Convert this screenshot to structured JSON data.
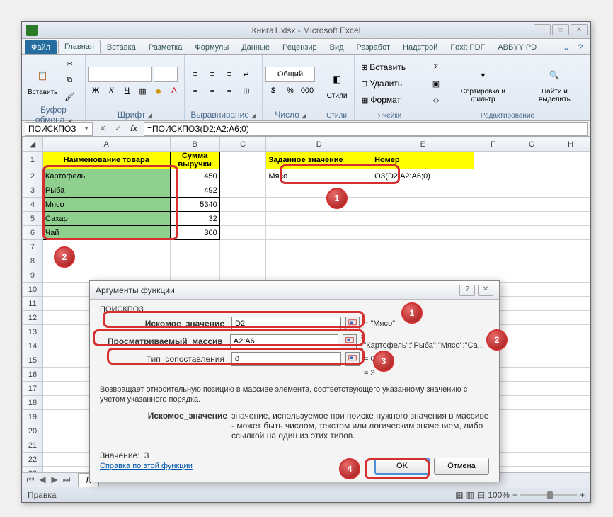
{
  "window": {
    "title": "Книга1.xlsx - Microsoft Excel"
  },
  "tabs": {
    "file": "Файл",
    "items": [
      "Главная",
      "Вставка",
      "Разметка",
      "Формулы",
      "Данные",
      "Рецензир",
      "Вид",
      "Разработ",
      "Надстрой",
      "Foxit PDF",
      "ABBYY PD"
    ],
    "active": 0
  },
  "ribbon": {
    "clipboard": {
      "paste": "Вставить",
      "label": "Буфер обмена"
    },
    "font": {
      "label": "Шрифт",
      "bold": "Ж",
      "italic": "К",
      "underline": "Ч"
    },
    "alignment": {
      "label": "Выравнивание"
    },
    "number": {
      "label": "Число",
      "format": "Общий"
    },
    "styles": {
      "label": "Стили",
      "btn": "Стили"
    },
    "cells": {
      "label": "Ячейки",
      "insert": "Вставить",
      "delete": "Удалить",
      "format": "Формат"
    },
    "editing": {
      "label": "Редактирование",
      "sort": "Сортировка и фильтр",
      "find": "Найти и выделить"
    }
  },
  "formula": {
    "namebox": "ПОИСКПОЗ",
    "formula": "=ПОИСКПОЗ(D2;A2:A6;0)"
  },
  "columns": [
    "A",
    "B",
    "C",
    "D",
    "E",
    "F",
    "G",
    "H"
  ],
  "rows_count": 23,
  "sheet": {
    "headers": {
      "a": "Наименование товара",
      "b": "Сумма выручки",
      "d": "Заданное значение",
      "e": "Номер"
    },
    "data": [
      {
        "a": "Картофель",
        "b": "450"
      },
      {
        "a": "Рыба",
        "b": "492"
      },
      {
        "a": "Мясо",
        "b": "5340"
      },
      {
        "a": "Сахар",
        "b": "32"
      },
      {
        "a": "Чай",
        "b": "300"
      }
    ],
    "d2": "Мясо",
    "e2": "ОЗ(D2;A2:A6;0)"
  },
  "dialog": {
    "title": "Аргументы функции",
    "fn": "ПОИСКПОЗ",
    "args": [
      {
        "label": "Искомое_значение",
        "value": "D2",
        "result": "= \"Мясо\""
      },
      {
        "label": "Просматриваемый_массив",
        "value": "A2:A6",
        "result": "= {\"Картофель\":\"Рыба\":\"Мясо\":\"Са..."
      },
      {
        "label": "Тип_сопоставления",
        "value": "0",
        "result": "= 0"
      }
    ],
    "eq_result": "= 3",
    "desc": "Возвращает относительную позицию в массиве элемента, соответствующего указанному значению с учетом указанного порядка.",
    "argdesc_label": "Искомое_значение",
    "argdesc": "значение, используемое при поиске нужного значения в массиве - может быть числом, текстом или логическим значением, либо ссылкой на один из этих типов.",
    "value_label": "Значение:",
    "value": "3",
    "help": "Справка по этой функции",
    "ok": "OK",
    "cancel": "Отмена"
  },
  "status": {
    "mode": "Правка",
    "zoom": "100%"
  },
  "sheet_tab": "Л",
  "badges": {
    "b1": "1",
    "b2": "2",
    "b3": "3",
    "b4": "4",
    "d1": "1",
    "d2": "2",
    "d3": "3"
  }
}
